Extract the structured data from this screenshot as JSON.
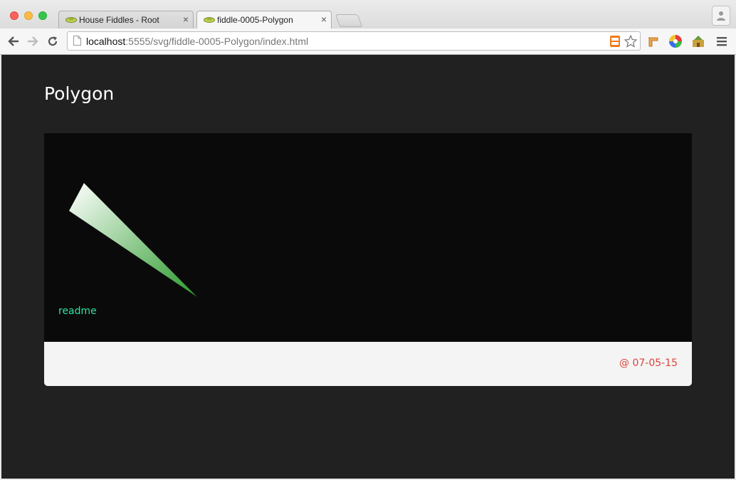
{
  "browser": {
    "tabs": [
      {
        "title": "House Fiddles - Root",
        "active": false
      },
      {
        "title": "fiddle-0005-Polygon",
        "active": true
      }
    ],
    "close_glyph": "×",
    "url": {
      "host": "localhost",
      "rest": ":5555/svg/fiddle-0005-Polygon/index.html"
    },
    "icons": [
      "back-arrow-icon",
      "forward-arrow-icon",
      "reload-icon",
      "page-icon",
      "extension-orange-icon",
      "bookmark-star-icon",
      "shortcut-icon",
      "color-wheel-icon",
      "theme-icon",
      "menu-icon",
      "profile-icon"
    ]
  },
  "page": {
    "title": "Polygon",
    "readme_link": "readme",
    "date": "@ 07-05-15",
    "colors": {
      "background": "#212121",
      "stage": "#0a0a0a",
      "link": "#2fe3a0",
      "date": "#d9453a",
      "polygon_gradient_start": "#ffffff",
      "polygon_gradient_end": "#2a9a2a"
    }
  }
}
